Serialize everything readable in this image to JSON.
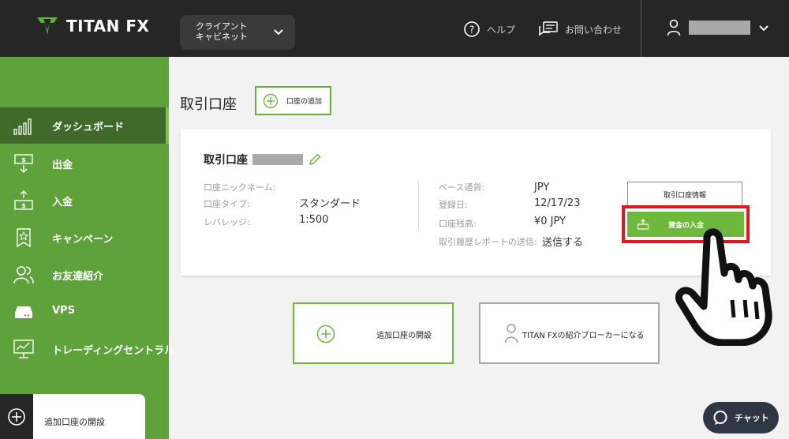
{
  "header": {
    "logo_text": "TITAN FX",
    "portal_switch_label": "クライアント\nキャビネット",
    "help_label": "ヘルプ",
    "contact_label": "お問い合わせ"
  },
  "sidebar": {
    "items": [
      {
        "label": "ダッシュボード",
        "icon": "bar-chart-icon",
        "active": true
      },
      {
        "label": "出金",
        "icon": "withdraw-icon",
        "active": false
      },
      {
        "label": "入金",
        "icon": "deposit-icon",
        "active": false
      },
      {
        "label": "キャンペーン",
        "icon": "star-badge-icon",
        "active": false
      },
      {
        "label": "お友達紹介",
        "icon": "users-icon",
        "active": false
      },
      {
        "label": "VPS",
        "icon": "server-icon",
        "active": false
      },
      {
        "label": "トレーディングセントラル",
        "icon": "monitor-chart-icon",
        "active": false
      }
    ],
    "open_extra_label": "追加口座の開設"
  },
  "main": {
    "title": "取引口座",
    "add_account_label": "口座の追加"
  },
  "account_card": {
    "title": "取引口座",
    "nickname_label": "口座ニックネーム:",
    "nickname_value": "",
    "type_label": "口座タイプ:",
    "type_value": "スタンダード",
    "leverage_label": "レバレッジ:",
    "leverage_value": "1:500",
    "currency_label": "ベース通貨:",
    "currency_value": "JPY",
    "registered_label": "登録日:",
    "registered_value": "12/17/23",
    "balance_label": "口座残高:",
    "balance_value": "¥0 JPY",
    "report_label": "取引履歴レポートの送信:",
    "report_value": "送信する",
    "info_button_label": "取引口座情報",
    "deposit_button_label": "資金の入金"
  },
  "actions": {
    "open_extra_label": "追加口座の開設",
    "become_ib_label": "TITAN FXの紹介ブローカーになる"
  },
  "chat": {
    "label": "チャット"
  },
  "colors": {
    "brand_green": "#6fb83e",
    "sidebar_green": "#5fa23b",
    "sidebar_active": "#3f6a2a",
    "header_dark": "#262626",
    "highlight_red": "#e0171f"
  }
}
